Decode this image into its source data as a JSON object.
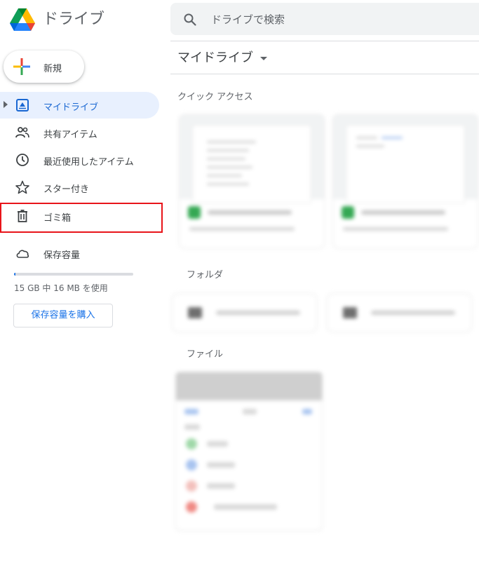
{
  "header": {
    "app_title": "ドライブ",
    "search_placeholder": "ドライブで検索"
  },
  "sidebar": {
    "new_label": "新規",
    "items": [
      {
        "label": "マイドライブ",
        "icon": "my-drive-icon",
        "active": true
      },
      {
        "label": "共有アイテム",
        "icon": "shared-people-icon",
        "active": false
      },
      {
        "label": "最近使用したアイテム",
        "icon": "clock-icon",
        "active": false
      },
      {
        "label": "スター付き",
        "icon": "star-icon",
        "active": false
      },
      {
        "label": "ゴミ箱",
        "icon": "trash-icon",
        "active": false
      },
      {
        "label": "保存容量",
        "icon": "cloud-icon",
        "active": false
      }
    ],
    "storage_text": "15 GB 中 16 MB を使用",
    "storage_used_fraction": 0.001,
    "buy_storage_label": "保存容量を購入"
  },
  "main": {
    "title": "マイドライブ",
    "quick_access_label": "クイック アクセス",
    "folders_label": "フォルダ",
    "files_label": "ファイル"
  },
  "colors": {
    "accent": "#1a73e8",
    "active_bg": "#e8f0fe",
    "highlight_border": "#e8141a"
  }
}
